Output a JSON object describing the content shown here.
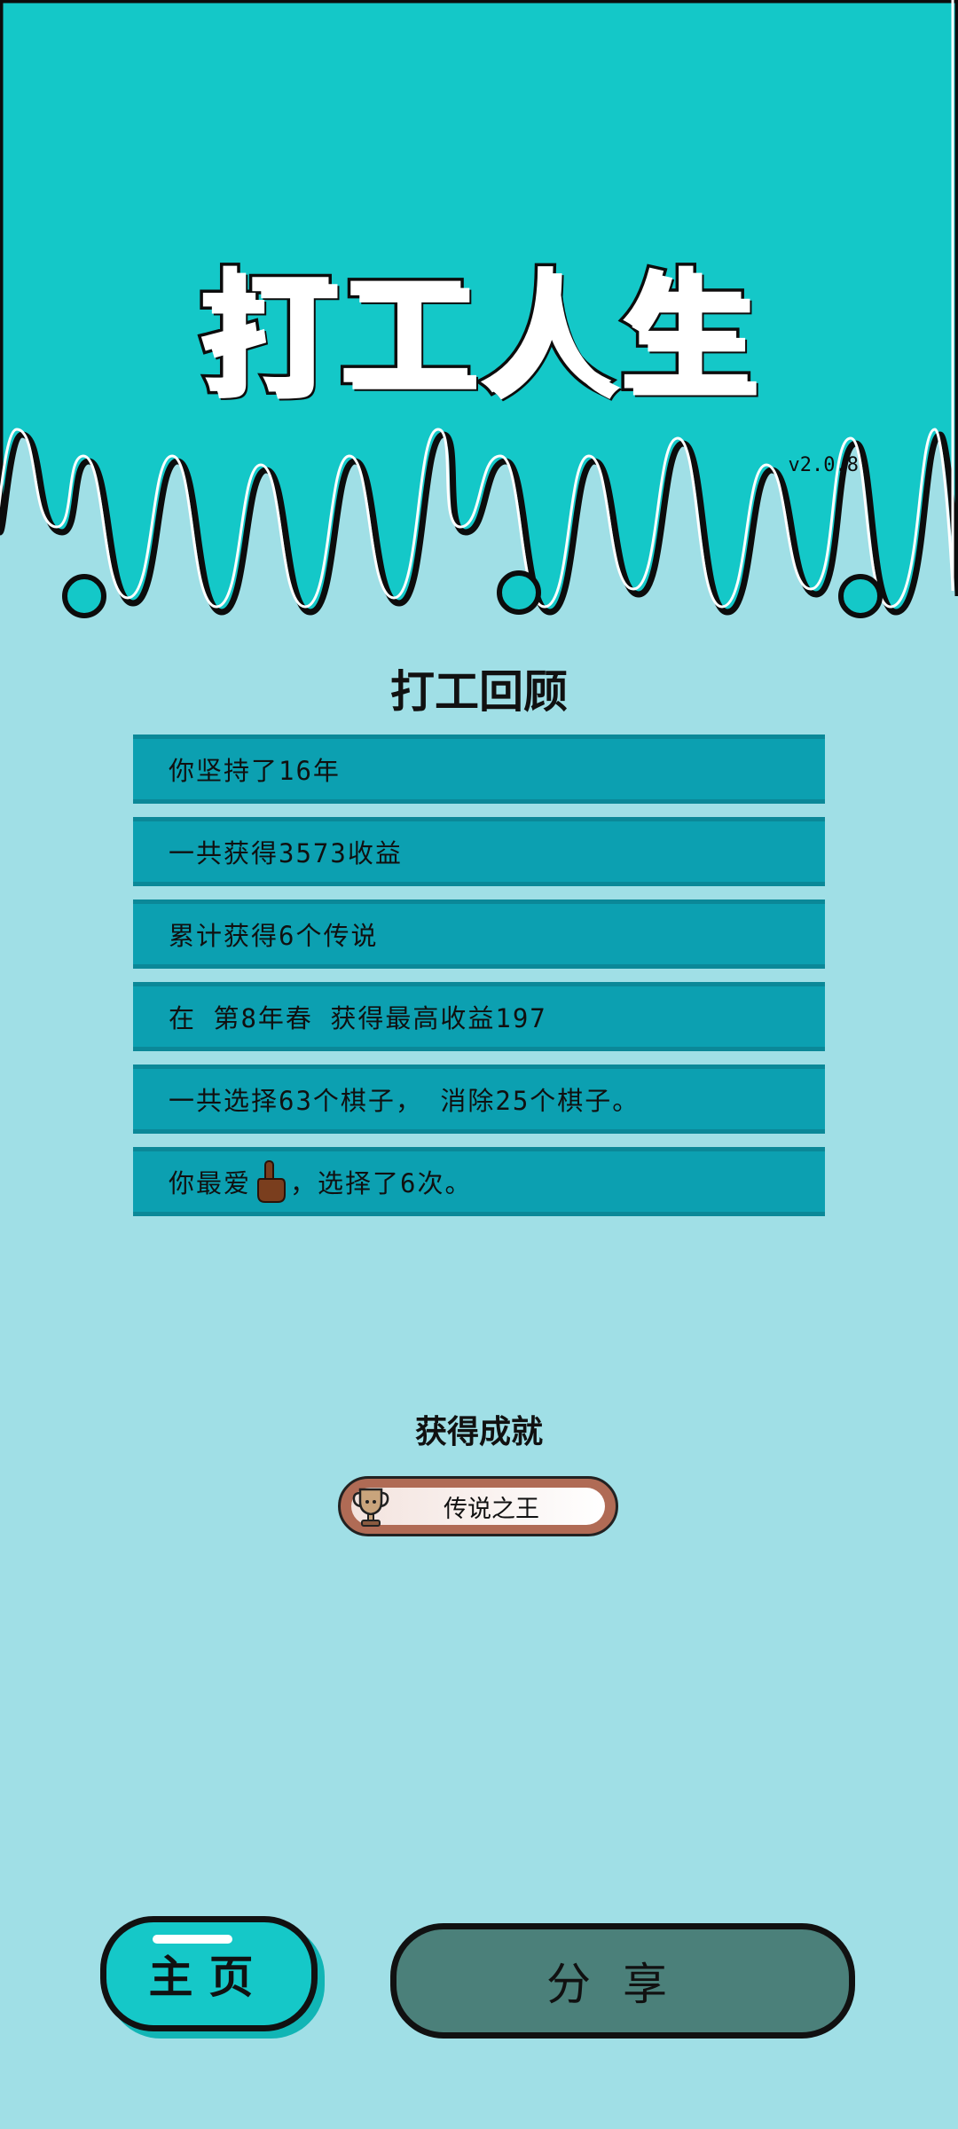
{
  "header": {
    "app_title": "打工人生",
    "version": "v2.0.8"
  },
  "review": {
    "title": "打工回顾",
    "rows": [
      {
        "text": "你坚持了16年"
      },
      {
        "text": "一共获得3573收益"
      },
      {
        "text": "累计获得6个传说"
      },
      {
        "text": "在 第8年春 获得最高收益197"
      },
      {
        "text": "一共选择63个棋子， 消除25个棋子。"
      },
      {
        "pre": "你最爱",
        "icon": "pointing-hand-icon",
        "post": "，选择了6次。"
      }
    ]
  },
  "achievements": {
    "title": "获得成就",
    "badge_label": "传说之王",
    "badge_icon": "trophy-icon"
  },
  "buttons": {
    "home_label": "主页",
    "share_label": "分享"
  },
  "colors": {
    "top_band": "#14c8c8",
    "background": "#a0dfe6",
    "stat_row": "#0ca0b1",
    "home_button": "#15c8c8",
    "share_button": "#4b807a"
  }
}
